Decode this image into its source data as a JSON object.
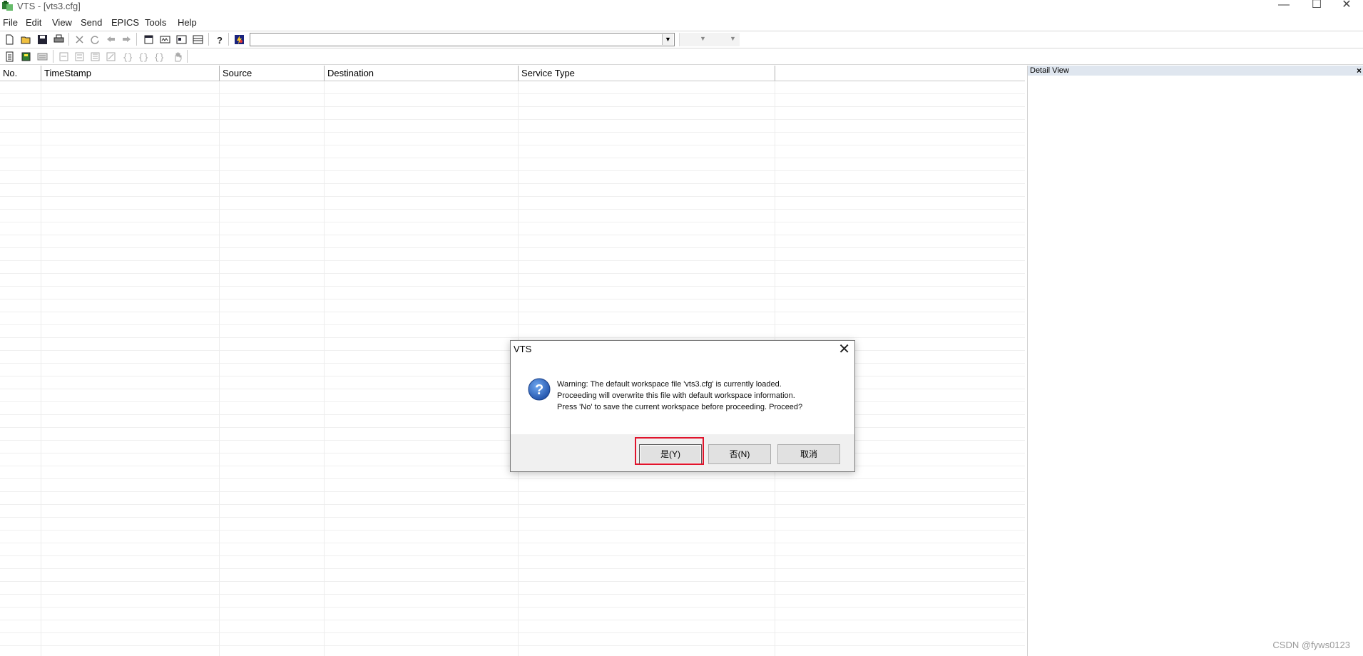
{
  "window": {
    "title": "VTS - [vts3.cfg]",
    "minimize": "—",
    "maximize": "☐",
    "close": "✕"
  },
  "menu": [
    "File",
    "Edit",
    "View",
    "Send",
    "EPICS",
    "Tools",
    "Help"
  ],
  "toolbar1": [
    "new-icon",
    "open-icon",
    "save-icon",
    "print-icon",
    "delete-icon",
    "refresh-icon",
    "back-icon",
    "forward-icon",
    "window-icon",
    "binary-icon",
    "panel-icon",
    "grid-icon",
    "help-icon",
    "flash-icon"
  ],
  "toolbar2": [
    "doc-icon",
    "book-icon",
    "script-icon",
    "step1-icon",
    "step2-icon",
    "step3-icon",
    "step4-icon",
    "brace1-icon",
    "brace2-icon",
    "brace3-icon",
    "hand-icon"
  ],
  "combo": {
    "value": "",
    "arrow": "▼"
  },
  "combo2": {
    "arrow1": "▼",
    "arrow2": "▼"
  },
  "grid": {
    "columns": [
      "No.",
      "TimeStamp",
      "Source",
      "Destination",
      "Service Type",
      ""
    ]
  },
  "detail": {
    "title": "Detail View",
    "close": "×"
  },
  "dialog": {
    "title": "VTS",
    "close": "✕",
    "message": [
      "Warning:  The default workspace file 'vts3.cfg' is currently loaded.",
      "Proceeding will overwrite this file with default workspace information.",
      "Press 'No' to save the current workspace before proceeding.  Proceed?"
    ],
    "buttons": {
      "yes": "是(Y)",
      "no": "否(N)",
      "cancel": "取消"
    }
  },
  "watermark": "CSDN @fyws0123"
}
